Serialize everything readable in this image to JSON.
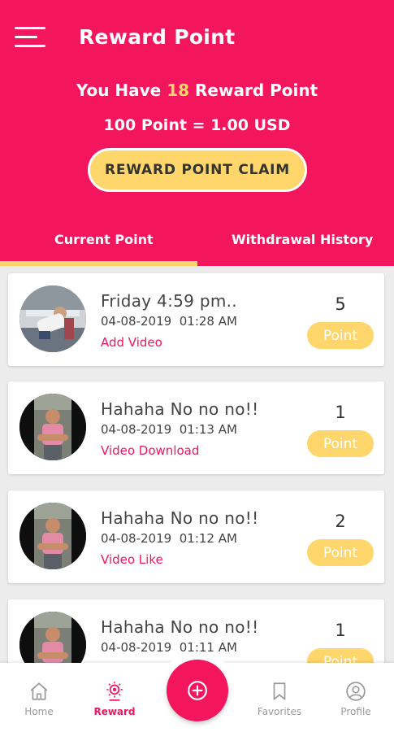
{
  "header": {
    "title": "Reward Point",
    "points_prefix": "You Have",
    "points_value": "18",
    "points_suffix": "Reward Point",
    "rate": "100 Point = 1.00 USD",
    "claim_button": "REWARD POINT CLAIM"
  },
  "tabs": [
    {
      "label": "Current Point",
      "active": true
    },
    {
      "label": "Withdrawal History",
      "active": false
    }
  ],
  "items": [
    {
      "title": "Friday 4:59 pm..",
      "date": "04-08-2019",
      "time": "01:28 AM",
      "type": "Add Video",
      "count": "5",
      "badge": "Point"
    },
    {
      "title": "Hahaha No no no!!",
      "date": "04-08-2019",
      "time": "01:13 AM",
      "type": "Video Download",
      "count": "1",
      "badge": "Point"
    },
    {
      "title": "Hahaha No no no!!",
      "date": "04-08-2019",
      "time": "01:12 AM",
      "type": "Video Like",
      "count": "2",
      "badge": "Point"
    },
    {
      "title": "Hahaha No no no!!",
      "date": "04-08-2019",
      "time": "01:11 AM",
      "type": "",
      "count": "1",
      "badge": "Point"
    }
  ],
  "bottom_nav": [
    {
      "label": "Home",
      "icon": "home-icon",
      "active": false
    },
    {
      "label": "Reward",
      "icon": "reward-icon",
      "active": true
    },
    {
      "label": "Favorites",
      "icon": "bookmark-icon",
      "active": false
    },
    {
      "label": "Profile",
      "icon": "profile-icon",
      "active": false
    }
  ],
  "fab": {
    "icon": "plus-icon"
  },
  "colors": {
    "primary": "#f3155d",
    "accent": "#ffd66b",
    "background": "#ececec",
    "nav_inactive": "#9a9a9a"
  }
}
